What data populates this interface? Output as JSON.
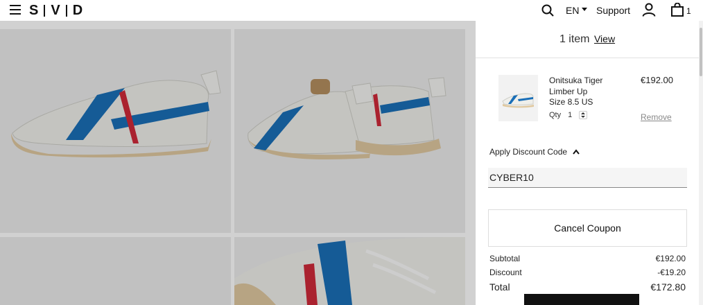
{
  "header": {
    "logo_letters": [
      "S",
      "V",
      "D"
    ],
    "language": "EN",
    "support": "Support",
    "bag_count": "1"
  },
  "cart": {
    "item_count_text": "1 item",
    "view_link": "View",
    "item": {
      "name": "Onitsuka Tiger Limber Up",
      "size": "Size 8.5 US",
      "qty_label": "Qty",
      "qty_value": "1",
      "price": "€192.00",
      "remove": "Remove"
    },
    "discount": {
      "toggle_label": "Apply Discount Code",
      "code_value": "CYBER10",
      "cancel_button": "Cancel Coupon"
    },
    "summary": {
      "subtotal_label": "Subtotal",
      "subtotal_value": "€192.00",
      "discount_label": "Discount",
      "discount_value": "-€19.20",
      "total_label": "Total",
      "total_value": "€172.80"
    }
  },
  "colors": {
    "shoe_white": "#eeeeea",
    "shoe_blue": "#1a6fb8",
    "shoe_red": "#d02a3a",
    "sole_tan": "#e2caa0"
  }
}
